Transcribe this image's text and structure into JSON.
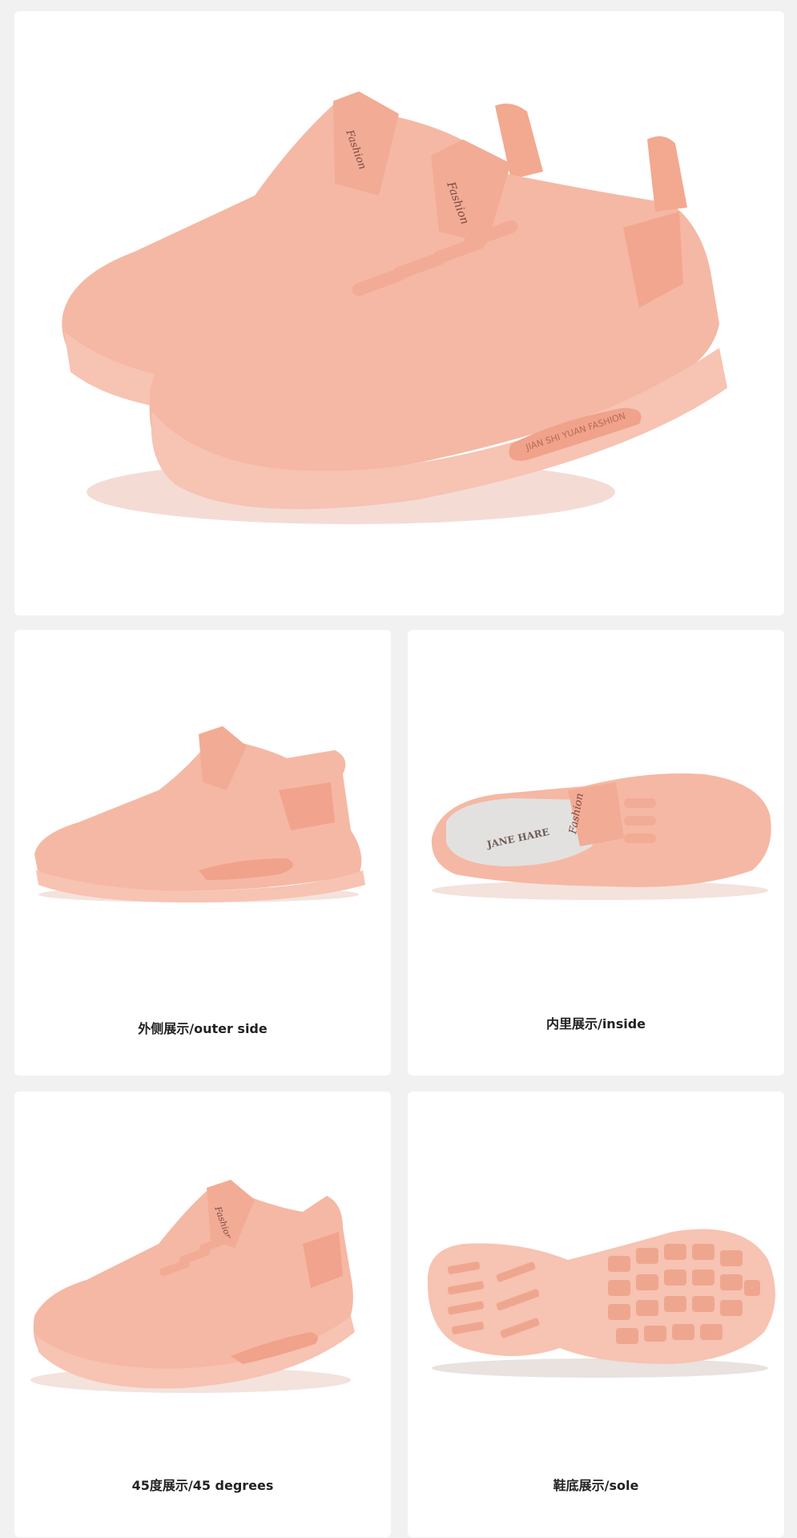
{
  "palette": {
    "page_bg": "#f1f1f1",
    "card_bg": "#ffffff",
    "shoe_knit": "#f5b8a4",
    "shoe_dark": "#eea28a",
    "shoe_sole": "#f7c3b2",
    "caption_text": "#222222"
  },
  "hero": {
    "tongue_brand": "Fashion",
    "sole_text": "JIAN SHI YUAN FASHION"
  },
  "panels": [
    {
      "caption": "外侧展示/outer side"
    },
    {
      "caption": "内里展示/inside",
      "insole_brand": "JANE HARE",
      "tongue_brand": "Fashion"
    },
    {
      "caption": "45度展示/45 degrees",
      "tongue_brand": "Fashion"
    },
    {
      "caption": "鞋底展示/sole"
    }
  ]
}
